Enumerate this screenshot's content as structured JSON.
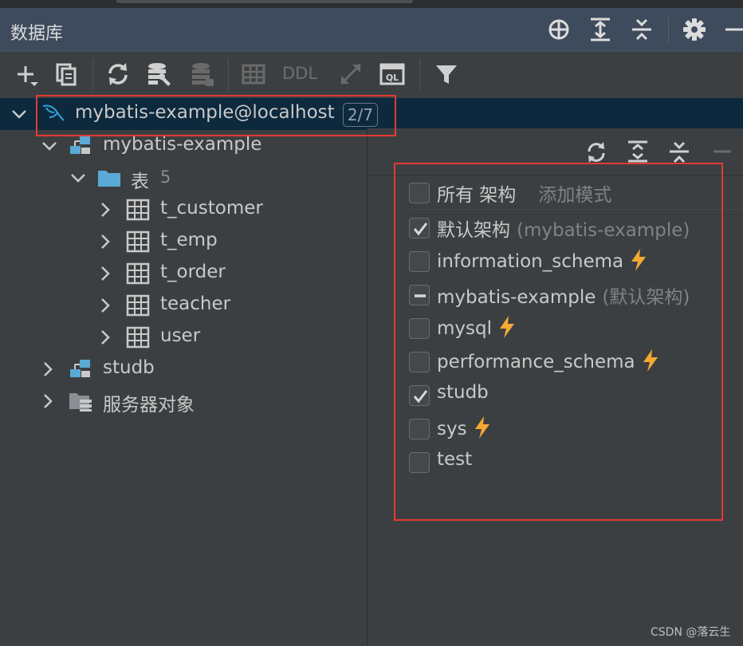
{
  "title": "数据库",
  "toolbar": {
    "ddl_label": "DDL"
  },
  "connection": {
    "name": "mybatis-example@localhost",
    "badge": "2/7"
  },
  "tree": {
    "schema_name": "mybatis-example",
    "tables_folder": "表",
    "tables_count": "5",
    "tables": [
      "t_customer",
      "t_emp",
      "t_order",
      "teacher",
      "user"
    ],
    "other_schema": "studb",
    "server_objects": "服务器对象"
  },
  "popup": {
    "header_label": "所有 架构",
    "header_hint": "添加模式",
    "schemas": [
      {
        "name": "默认架构",
        "hint": "(mybatis-example)",
        "state": "checked",
        "bolt": false
      },
      {
        "name": "information_schema",
        "hint": "",
        "state": "unchecked",
        "bolt": true
      },
      {
        "name": "mybatis-example",
        "hint": "(默认架构)",
        "state": "indeterminate",
        "bolt": false
      },
      {
        "name": "mysql",
        "hint": "",
        "state": "unchecked",
        "bolt": true
      },
      {
        "name": "performance_schema",
        "hint": "",
        "state": "unchecked",
        "bolt": true
      },
      {
        "name": "studb",
        "hint": "",
        "state": "checked",
        "bolt": false
      },
      {
        "name": "sys",
        "hint": "",
        "state": "unchecked",
        "bolt": true
      },
      {
        "name": "test",
        "hint": "",
        "state": "unchecked",
        "bolt": false
      }
    ]
  },
  "watermark": "CSDN @落云生",
  "colors": {
    "accent_selected": "#0d293e",
    "highlight_box": "#e53935",
    "bolt": "#f4a933"
  }
}
